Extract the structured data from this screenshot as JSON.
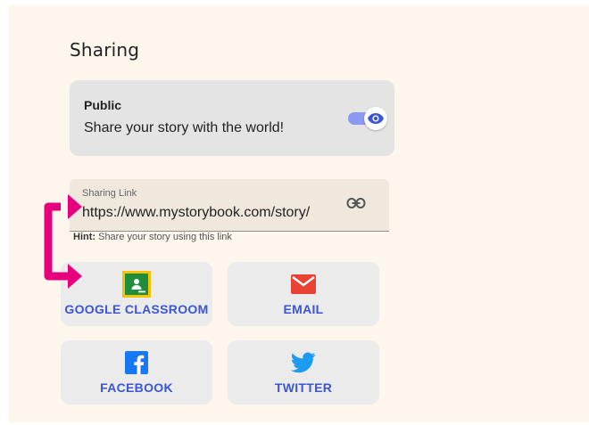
{
  "section": {
    "title": "Sharing"
  },
  "public": {
    "title": "Public",
    "description": "Share your story with the world!",
    "enabled": true
  },
  "sharing_link": {
    "label": "Sharing Link",
    "value": "https://www.mystorybook.com/story/",
    "hint_label": "Hint:",
    "hint_text": " Share your story using this link"
  },
  "share_buttons": {
    "google_classroom": "GOOGLE CLASSROOM",
    "email": "EMAIL",
    "facebook": "FACEBOOK",
    "twitter": "TWITTER"
  },
  "colors": {
    "accent": "#3a56d4",
    "annotation": "#e6007e",
    "panel_bg": "#fdf6ec"
  }
}
